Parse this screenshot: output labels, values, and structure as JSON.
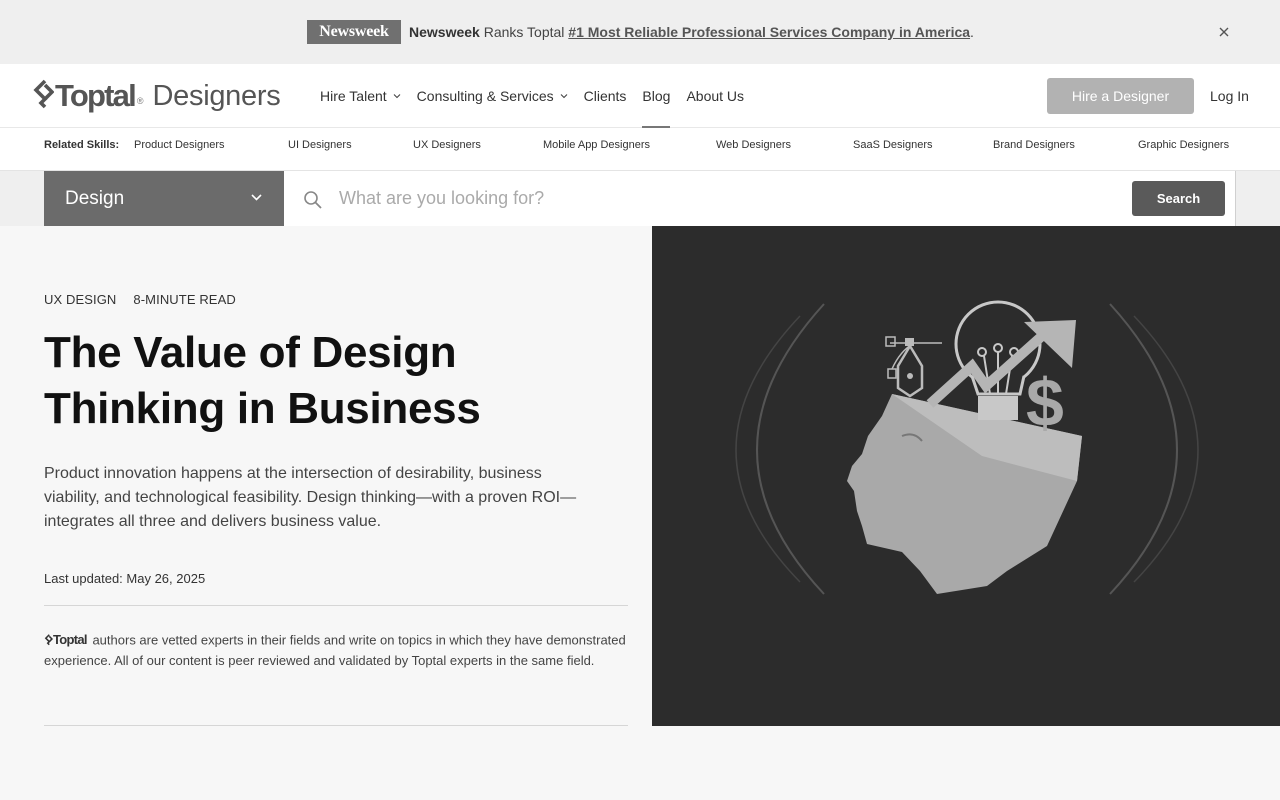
{
  "announcement": {
    "logo_text": "Newsweek",
    "brand": "Newsweek",
    "text": " Ranks Toptal ",
    "link": "#1 Most Reliable Professional Services Company in America",
    "suffix": "."
  },
  "header": {
    "logo_word": "Toptal",
    "logo_reg": "®",
    "logo_sub": "Designers",
    "nav": [
      {
        "label": "Hire Talent",
        "dropdown": true
      },
      {
        "label": "Consulting & Services",
        "dropdown": true
      },
      {
        "label": "Clients",
        "dropdown": false
      },
      {
        "label": "Blog",
        "dropdown": false,
        "active": true
      },
      {
        "label": "About Us",
        "dropdown": false
      }
    ],
    "cta": "Hire a Designer",
    "login": "Log In"
  },
  "skills": {
    "label": "Related Skills:",
    "items": [
      "Product Designers",
      "UI Designers",
      "UX Designers",
      "Mobile App Designers",
      "Web Designers",
      "SaaS Designers",
      "Brand Designers",
      "Graphic Designers"
    ]
  },
  "search": {
    "category": "Design",
    "placeholder": "What are you looking for?",
    "value": "",
    "button": "Search"
  },
  "article": {
    "category": "UX DESIGN",
    "read_time": "8-MINUTE READ",
    "title": "The Value of Design Thinking in Business",
    "lede": "Product innovation happens at the intersection of desirability, business viability, and technological feasibility. Design thinking—with a proven ROI—integrates all three and delivers business value.",
    "updated": "Last updated: May 26, 2025",
    "vetted_logo": "Toptal",
    "vetted_text": " authors are vetted experts in their fields and write on topics in which they have demonstrated experience. All of our content is peer reviewed and validated by Toptal experts in the same field."
  },
  "icons": {
    "close": "close-icon",
    "search": "search-icon",
    "chevron": "chevron-down-icon",
    "hero": "head-lightbulb-illustration"
  },
  "colors": {
    "announce_bg": "#efefef",
    "hero_bg": "#2c2c2c",
    "cta_bg": "#b2b2b2",
    "search_btn": "#5a5a5a",
    "category_bg": "#6b6b6b"
  }
}
